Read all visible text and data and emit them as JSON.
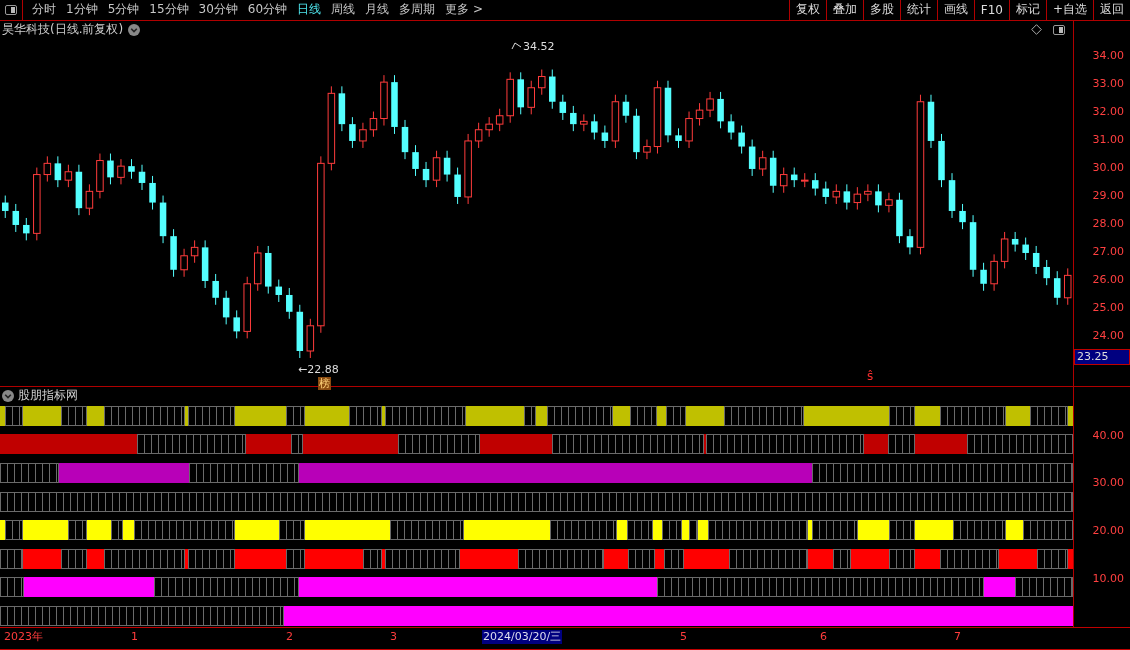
{
  "toolbar": {
    "periods": [
      {
        "label": "分时",
        "selected": false
      },
      {
        "label": "1分钟",
        "selected": false
      },
      {
        "label": "5分钟",
        "selected": false
      },
      {
        "label": "15分钟",
        "selected": false
      },
      {
        "label": "30分钟",
        "selected": false
      },
      {
        "label": "60分钟",
        "selected": false
      },
      {
        "label": "日线",
        "selected": true
      },
      {
        "label": "周线",
        "selected": false
      },
      {
        "label": "月线",
        "selected": false
      },
      {
        "label": "多周期",
        "selected": false
      },
      {
        "label": "更多 >",
        "selected": false
      }
    ],
    "buttons": [
      "复权",
      "叠加",
      "多股",
      "统计",
      "画线",
      "F10",
      "标记",
      "+自选",
      "返回"
    ]
  },
  "main_chart": {
    "title": "昊华科技(日线.前复权)",
    "price_ticks": [
      "34.00",
      "33.00",
      "32.00",
      "31.00",
      "30.00",
      "29.00",
      "28.00",
      "27.00",
      "26.00",
      "25.00",
      "24.00"
    ],
    "low_label": "←22.88",
    "high_label": "34.52",
    "badge": "榜",
    "signal": "ŝ",
    "current_price": "23.25"
  },
  "indicator": {
    "title": "股朋指标网",
    "yticks": [
      "40.00",
      "30.00",
      "20.00",
      "10.00"
    ],
    "strips": [
      {
        "color": "#c0c000",
        "segments": [
          {
            "filled": true
          },
          {
            "filled": false
          },
          {
            "filled": true
          },
          {
            "filled": false
          },
          {
            "filled": true
          },
          {
            "filled": false
          },
          {
            "filled": true
          },
          {
            "filled": false
          },
          {
            "filled": true
          },
          {
            "filled": false
          },
          {
            "filled": true
          },
          {
            "filled": false
          },
          {
            "filled": true
          },
          {
            "filled": false
          },
          {
            "filled": true
          },
          {
            "filled": false
          },
          {
            "filled": true
          },
          {
            "filled": false
          },
          {
            "filled": true
          },
          {
            "filled": false
          },
          {
            "filled": true
          },
          {
            "filled": false
          },
          {
            "filled": true
          },
          {
            "filled": false
          },
          {
            "filled": true
          },
          {
            "filled": false
          },
          {
            "filled": true
          },
          {
            "filled": false
          },
          {
            "filled": true
          },
          {
            "filled": false
          },
          {
            "filled": true
          }
        ]
      },
      {
        "color": "#c00000",
        "segments": [
          {
            "filled": true
          },
          {
            "filled": false
          },
          {
            "filled": true
          },
          {
            "filled": false
          },
          {
            "filled": true
          },
          {
            "filled": false
          },
          {
            "filled": true
          },
          {
            "filled": false
          },
          {
            "filled": true
          },
          {
            "filled": false
          },
          {
            "filled": true
          },
          {
            "filled": false
          },
          {
            "filled": true
          },
          {
            "filled": false
          }
        ]
      },
      {
        "color": "#b800b8",
        "segments": [
          {
            "filled": false
          },
          {
            "filled": true
          },
          {
            "filled": false
          },
          {
            "filled": true
          },
          {
            "filled": false
          }
        ]
      },
      {
        "segments": [
          {
            "filled": false
          }
        ]
      },
      {
        "color": "#ffff00",
        "segments": [
          {
            "filled": true
          },
          {
            "filled": false
          },
          {
            "filled": true
          },
          {
            "filled": false
          },
          {
            "filled": true
          },
          {
            "filled": false
          },
          {
            "filled": true
          },
          {
            "filled": false
          },
          {
            "filled": true
          },
          {
            "filled": false
          },
          {
            "filled": true
          },
          {
            "filled": false
          },
          {
            "filled": true
          },
          {
            "filled": false
          },
          {
            "filled": true
          },
          {
            "filled": false
          },
          {
            "filled": true
          },
          {
            "filled": false
          },
          {
            "filled": true
          },
          {
            "filled": false
          },
          {
            "filled": true
          },
          {
            "filled": false
          },
          {
            "filled": true
          },
          {
            "filled": false
          },
          {
            "filled": true
          },
          {
            "filled": false
          },
          {
            "filled": true
          },
          {
            "filled": false
          },
          {
            "filled": true
          },
          {
            "filled": false
          }
        ]
      },
      {
        "color": "#ff0000",
        "segments": [
          {
            "filled": false
          },
          {
            "filled": true
          },
          {
            "filled": false
          },
          {
            "filled": true
          },
          {
            "filled": false
          },
          {
            "filled": true
          },
          {
            "filled": false
          },
          {
            "filled": true
          },
          {
            "filled": false
          },
          {
            "filled": true
          },
          {
            "filled": false
          },
          {
            "filled": true
          },
          {
            "filled": false
          },
          {
            "filled": true
          },
          {
            "filled": false
          },
          {
            "filled": true
          },
          {
            "filled": false
          },
          {
            "filled": true
          },
          {
            "filled": false
          },
          {
            "filled": true
          },
          {
            "filled": false
          },
          {
            "filled": true
          },
          {
            "filled": false
          },
          {
            "filled": true
          },
          {
            "filled": false
          },
          {
            "filled": true
          },
          {
            "filled": false
          },
          {
            "filled": true
          },
          {
            "filled": false
          },
          {
            "filled": true
          }
        ]
      },
      {
        "color": "#ff00ff",
        "segments": [
          {
            "filled": false
          },
          {
            "filled": true
          },
          {
            "filled": false
          },
          {
            "filled": true
          },
          {
            "filled": false
          },
          {
            "filled": true
          },
          {
            "filled": false
          }
        ]
      },
      {
        "color": "#ff00ff",
        "segments": [
          {
            "filled": false
          },
          {
            "filled": true
          }
        ]
      }
    ]
  },
  "date_axis": [
    {
      "label": "2023年",
      "selected": false
    },
    {
      "label": "1",
      "selected": false
    },
    {
      "label": "2",
      "selected": false
    },
    {
      "label": "3",
      "selected": false
    },
    {
      "label": "2024/03/20/三",
      "selected": true
    },
    {
      "label": "5",
      "selected": false
    },
    {
      "label": "6",
      "selected": false
    },
    {
      "label": "7",
      "selected": false
    }
  ]
}
